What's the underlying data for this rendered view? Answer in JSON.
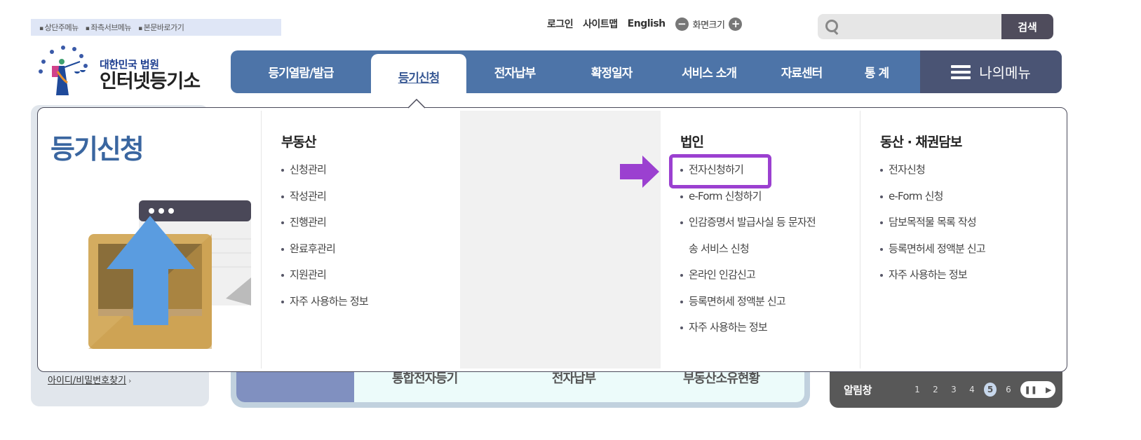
{
  "skip_links": [
    "상단주메뉴",
    "좌측서브메뉴",
    "본문바로가기"
  ],
  "util": {
    "login": "로그인",
    "sitemap": "사이트맵",
    "english": "English",
    "zoom_label": "화면크기",
    "zoom_out_icon": "minus-circle-icon",
    "zoom_in_icon": "plus-circle-icon"
  },
  "search": {
    "placeholder": "",
    "value": "",
    "button_label": "검색"
  },
  "logo": {
    "sub": "대한민국 법원",
    "main": "인터넷등기소"
  },
  "gnb": {
    "items": [
      {
        "label": "등기열람/발급",
        "active": false
      },
      {
        "label": "등기신청",
        "active": true
      },
      {
        "label": "전자납부",
        "active": false
      },
      {
        "label": "확정일자",
        "active": false
      },
      {
        "label": "서비스 소개",
        "active": false
      },
      {
        "label": "자료센터",
        "active": false
      },
      {
        "label": "통 계",
        "active": false
      }
    ],
    "mymenu_label": "나의메뉴"
  },
  "dropdown": {
    "title": "등기신청",
    "columns": [
      {
        "heading": "부동산",
        "items": [
          "신청관리",
          "작성관리",
          "진행관리",
          "완료후관리",
          "지원관리",
          "자주 사용하는 정보"
        ]
      },
      {
        "heading": "",
        "items": []
      },
      {
        "heading": "법인",
        "items": [
          "전자신청하기",
          "e-Form 신청하기",
          "인감증명서 발급사실 등 문자전",
          "송 서비스 신청",
          "온라인 인감신고",
          "등록면허세 정액분 신고",
          "자주 사용하는 정보"
        ]
      },
      {
        "heading": "동산 · 채권담보",
        "items": [
          "전자신청",
          "e-Form 신청",
          "담보목적물 목록 작성",
          "등록면허세 정액분 신고",
          "자주 사용하는 정보"
        ]
      }
    ],
    "highlighted_item": "전자신청하기",
    "highlight_color": "#9b40d0"
  },
  "background": {
    "find_id_link": "아이디/비밀번호찾기",
    "quick_links": [
      "통합전자등기",
      "전자납부",
      "부동산소유현황"
    ],
    "alert": {
      "title": "알림창",
      "pages": [
        "1",
        "2",
        "3",
        "4",
        "5",
        "6"
      ],
      "current_page": "5"
    }
  },
  "colors": {
    "gnb_bg": "#4d74a8",
    "mymenu_bg": "#4a5474",
    "title_blue": "#3a66a0",
    "highlight": "#9b40d0"
  }
}
